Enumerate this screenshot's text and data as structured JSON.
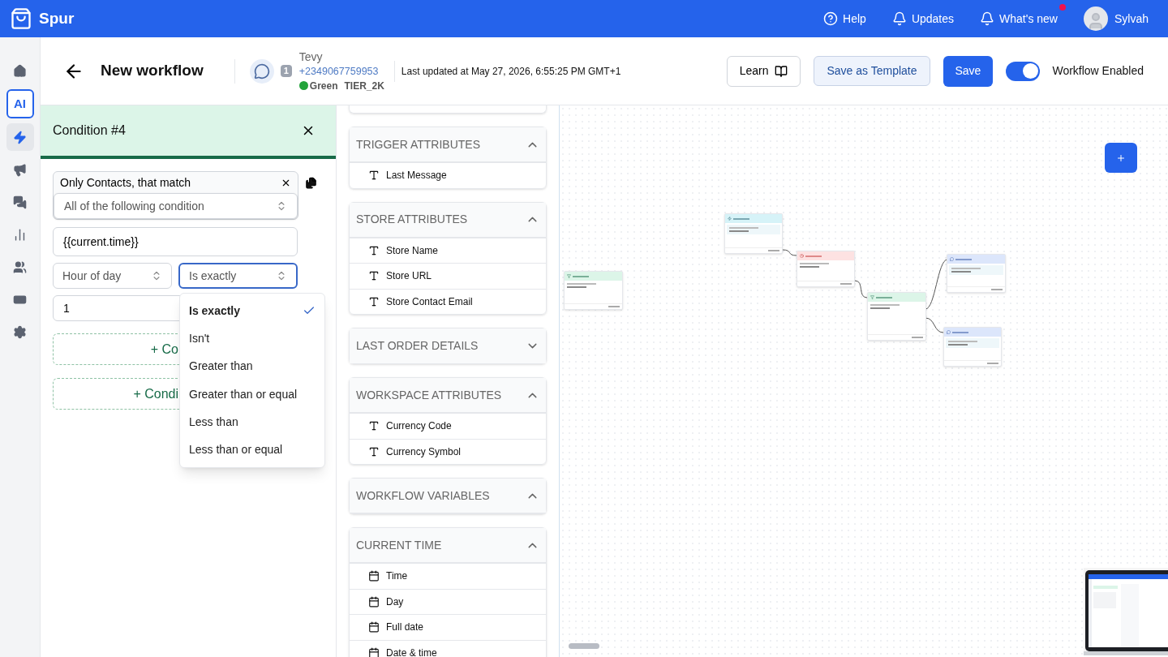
{
  "topbar": {
    "brand": "Spur",
    "links": [
      {
        "kind": "help",
        "label": "Help",
        "notification": false
      },
      {
        "kind": "updates",
        "label": "Updates",
        "notification": false
      },
      {
        "kind": "news",
        "label": "What's new",
        "notification": true
      }
    ],
    "user": "Sylvah"
  },
  "rail": [
    {
      "kind": "home",
      "selected": false
    },
    {
      "kind": "ai",
      "label": "AI",
      "selected": false
    },
    {
      "kind": "bolt",
      "selected": true
    },
    {
      "kind": "megaphone",
      "selected": false
    },
    {
      "kind": "chat",
      "selected": false
    },
    {
      "kind": "chart",
      "selected": false
    },
    {
      "kind": "users",
      "selected": false
    },
    {
      "kind": "money",
      "selected": false
    },
    {
      "kind": "settings",
      "selected": false
    }
  ],
  "header": {
    "title": "New workflow",
    "channel_count": "1",
    "contact_name": "Tevy",
    "phone": "+2349067759953",
    "tag": "Green",
    "tier": "TIER_2K",
    "last_updated": "Last updated at May 27, 2026, 6:55:25 PM GMT+1",
    "buttons": [
      {
        "kind": "learn",
        "label": "Learn"
      },
      {
        "kind": "template",
        "label": "Save as Template"
      },
      {
        "kind": "save",
        "label": "Save"
      }
    ],
    "toggle": {
      "label": "Workflow Enabled",
      "on": true
    }
  },
  "condition": {
    "title": "Condition #4",
    "match_label": "Only Contacts, that match",
    "match_mode": "All of the following condition",
    "variable": "{{current.time}}",
    "attribute": "Hour of day",
    "operator": "Is exactly",
    "value": "1",
    "add_buttons": [
      "+ Co",
      "+ Condi"
    ],
    "operator_options": [
      {
        "label": "Is exactly",
        "selected": true
      },
      {
        "label": "Isn't",
        "selected": false
      },
      {
        "label": "Greater than",
        "selected": false
      },
      {
        "label": "Greater than or equal",
        "selected": false
      },
      {
        "label": "Less than",
        "selected": false
      },
      {
        "label": "Less than or equal",
        "selected": false
      }
    ]
  },
  "attributes": [
    {
      "title": "TRIGGER ATTRIBUTES",
      "expanded": true,
      "items": [
        {
          "kind": "text",
          "label": "Last Message"
        }
      ]
    },
    {
      "title": "STORE ATTRIBUTES",
      "expanded": true,
      "items": [
        {
          "kind": "text",
          "label": "Store Name"
        },
        {
          "kind": "text",
          "label": "Store URL"
        },
        {
          "kind": "text",
          "label": "Store Contact Email"
        }
      ]
    },
    {
      "title": "LAST ORDER DETAILS",
      "expanded": false
    },
    {
      "title": "WORKSPACE ATTRIBUTES",
      "expanded": true,
      "items": [
        {
          "kind": "text",
          "label": "Currency Code"
        },
        {
          "kind": "text",
          "label": "Currency Symbol"
        }
      ]
    },
    {
      "title": "WORKFLOW VARIABLES",
      "expanded": true
    },
    {
      "title": "CURRENT TIME",
      "expanded": true,
      "items": [
        {
          "kind": "date",
          "label": "Time"
        },
        {
          "kind": "date",
          "label": "Day"
        },
        {
          "kind": "date",
          "label": "Full date"
        },
        {
          "kind": "date",
          "label": "Date & time"
        }
      ]
    }
  ],
  "canvas": {
    "nodes": [
      {
        "kind": "condition"
      },
      {
        "kind": "trigger"
      },
      {
        "kind": "delay"
      },
      {
        "kind": "condition"
      },
      {
        "kind": "message"
      },
      {
        "kind": "message"
      }
    ]
  }
}
